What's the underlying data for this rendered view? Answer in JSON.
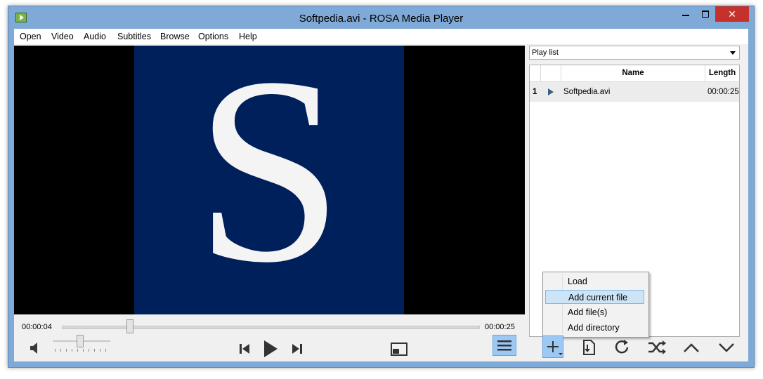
{
  "window": {
    "title": "Softpedia.avi - ROSA Media Player",
    "close_glyph": "✕"
  },
  "menu": {
    "items": [
      "Open",
      "Video",
      "Audio",
      "Subtitles",
      "Browse",
      "Options",
      "Help"
    ]
  },
  "video": {
    "letter": "S",
    "frame_color": "#00205b"
  },
  "player": {
    "elapsed": "00:00:04",
    "total": "00:00:25",
    "seek_progress": 0.16,
    "volume_level": 0.5
  },
  "playlist": {
    "selector": "Play list",
    "columns": {
      "name": "Name",
      "length": "Length"
    },
    "rows": [
      {
        "index": "1",
        "name": "Softpedia.avi",
        "length": "00:00:25",
        "playing": true
      }
    ]
  },
  "context_menu": {
    "items": [
      "Load",
      "Add current file",
      "Add file(s)",
      "Add directory"
    ],
    "highlighted": "Add current file"
  },
  "icons": {
    "app": "rosa-media-player-icon",
    "volume": "speaker-icon",
    "previous": "skip-previous-icon",
    "play": "play-icon",
    "next": "skip-next-icon",
    "fullscreen": "fullscreen-icon",
    "playlist_toggle": "menu-icon",
    "add": "add-icon",
    "save": "save-playlist-icon",
    "repeat": "repeat-icon",
    "shuffle": "shuffle-icon",
    "move_up": "chevron-up-icon",
    "move_down": "chevron-down-icon"
  },
  "colors": {
    "title_bar": "#7fa9d6",
    "close_button": "#c7312b",
    "accent_button": "#9cc8f4",
    "highlight": "#cde4f7"
  }
}
